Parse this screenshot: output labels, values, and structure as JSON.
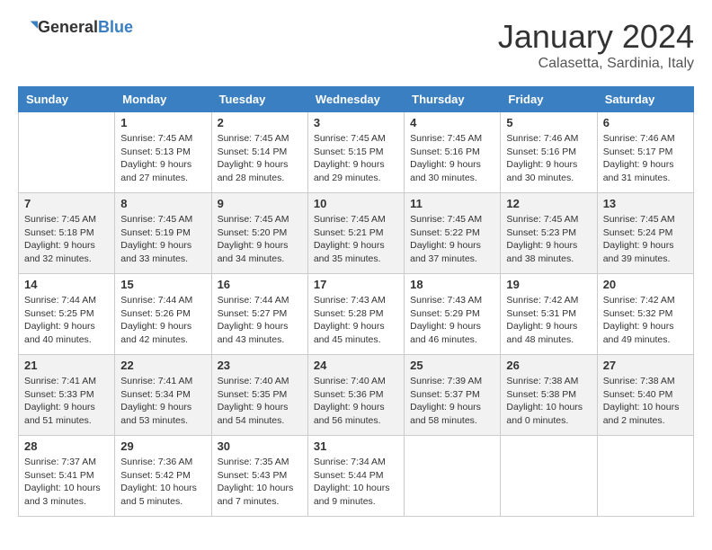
{
  "header": {
    "logo_general": "General",
    "logo_blue": "Blue",
    "month_year": "January 2024",
    "location": "Calasetta, Sardinia, Italy"
  },
  "days_of_week": [
    "Sunday",
    "Monday",
    "Tuesday",
    "Wednesday",
    "Thursday",
    "Friday",
    "Saturday"
  ],
  "weeks": [
    [
      {
        "day": "",
        "sunrise": "",
        "sunset": "",
        "daylight": ""
      },
      {
        "day": "1",
        "sunrise": "Sunrise: 7:45 AM",
        "sunset": "Sunset: 5:13 PM",
        "daylight": "Daylight: 9 hours and 27 minutes."
      },
      {
        "day": "2",
        "sunrise": "Sunrise: 7:45 AM",
        "sunset": "Sunset: 5:14 PM",
        "daylight": "Daylight: 9 hours and 28 minutes."
      },
      {
        "day": "3",
        "sunrise": "Sunrise: 7:45 AM",
        "sunset": "Sunset: 5:15 PM",
        "daylight": "Daylight: 9 hours and 29 minutes."
      },
      {
        "day": "4",
        "sunrise": "Sunrise: 7:45 AM",
        "sunset": "Sunset: 5:16 PM",
        "daylight": "Daylight: 9 hours and 30 minutes."
      },
      {
        "day": "5",
        "sunrise": "Sunrise: 7:46 AM",
        "sunset": "Sunset: 5:16 PM",
        "daylight": "Daylight: 9 hours and 30 minutes."
      },
      {
        "day": "6",
        "sunrise": "Sunrise: 7:46 AM",
        "sunset": "Sunset: 5:17 PM",
        "daylight": "Daylight: 9 hours and 31 minutes."
      }
    ],
    [
      {
        "day": "7",
        "sunrise": "Sunrise: 7:45 AM",
        "sunset": "Sunset: 5:18 PM",
        "daylight": "Daylight: 9 hours and 32 minutes."
      },
      {
        "day": "8",
        "sunrise": "Sunrise: 7:45 AM",
        "sunset": "Sunset: 5:19 PM",
        "daylight": "Daylight: 9 hours and 33 minutes."
      },
      {
        "day": "9",
        "sunrise": "Sunrise: 7:45 AM",
        "sunset": "Sunset: 5:20 PM",
        "daylight": "Daylight: 9 hours and 34 minutes."
      },
      {
        "day": "10",
        "sunrise": "Sunrise: 7:45 AM",
        "sunset": "Sunset: 5:21 PM",
        "daylight": "Daylight: 9 hours and 35 minutes."
      },
      {
        "day": "11",
        "sunrise": "Sunrise: 7:45 AM",
        "sunset": "Sunset: 5:22 PM",
        "daylight": "Daylight: 9 hours and 37 minutes."
      },
      {
        "day": "12",
        "sunrise": "Sunrise: 7:45 AM",
        "sunset": "Sunset: 5:23 PM",
        "daylight": "Daylight: 9 hours and 38 minutes."
      },
      {
        "day": "13",
        "sunrise": "Sunrise: 7:45 AM",
        "sunset": "Sunset: 5:24 PM",
        "daylight": "Daylight: 9 hours and 39 minutes."
      }
    ],
    [
      {
        "day": "14",
        "sunrise": "Sunrise: 7:44 AM",
        "sunset": "Sunset: 5:25 PM",
        "daylight": "Daylight: 9 hours and 40 minutes."
      },
      {
        "day": "15",
        "sunrise": "Sunrise: 7:44 AM",
        "sunset": "Sunset: 5:26 PM",
        "daylight": "Daylight: 9 hours and 42 minutes."
      },
      {
        "day": "16",
        "sunrise": "Sunrise: 7:44 AM",
        "sunset": "Sunset: 5:27 PM",
        "daylight": "Daylight: 9 hours and 43 minutes."
      },
      {
        "day": "17",
        "sunrise": "Sunrise: 7:43 AM",
        "sunset": "Sunset: 5:28 PM",
        "daylight": "Daylight: 9 hours and 45 minutes."
      },
      {
        "day": "18",
        "sunrise": "Sunrise: 7:43 AM",
        "sunset": "Sunset: 5:29 PM",
        "daylight": "Daylight: 9 hours and 46 minutes."
      },
      {
        "day": "19",
        "sunrise": "Sunrise: 7:42 AM",
        "sunset": "Sunset: 5:31 PM",
        "daylight": "Daylight: 9 hours and 48 minutes."
      },
      {
        "day": "20",
        "sunrise": "Sunrise: 7:42 AM",
        "sunset": "Sunset: 5:32 PM",
        "daylight": "Daylight: 9 hours and 49 minutes."
      }
    ],
    [
      {
        "day": "21",
        "sunrise": "Sunrise: 7:41 AM",
        "sunset": "Sunset: 5:33 PM",
        "daylight": "Daylight: 9 hours and 51 minutes."
      },
      {
        "day": "22",
        "sunrise": "Sunrise: 7:41 AM",
        "sunset": "Sunset: 5:34 PM",
        "daylight": "Daylight: 9 hours and 53 minutes."
      },
      {
        "day": "23",
        "sunrise": "Sunrise: 7:40 AM",
        "sunset": "Sunset: 5:35 PM",
        "daylight": "Daylight: 9 hours and 54 minutes."
      },
      {
        "day": "24",
        "sunrise": "Sunrise: 7:40 AM",
        "sunset": "Sunset: 5:36 PM",
        "daylight": "Daylight: 9 hours and 56 minutes."
      },
      {
        "day": "25",
        "sunrise": "Sunrise: 7:39 AM",
        "sunset": "Sunset: 5:37 PM",
        "daylight": "Daylight: 9 hours and 58 minutes."
      },
      {
        "day": "26",
        "sunrise": "Sunrise: 7:38 AM",
        "sunset": "Sunset: 5:38 PM",
        "daylight": "Daylight: 10 hours and 0 minutes."
      },
      {
        "day": "27",
        "sunrise": "Sunrise: 7:38 AM",
        "sunset": "Sunset: 5:40 PM",
        "daylight": "Daylight: 10 hours and 2 minutes."
      }
    ],
    [
      {
        "day": "28",
        "sunrise": "Sunrise: 7:37 AM",
        "sunset": "Sunset: 5:41 PM",
        "daylight": "Daylight: 10 hours and 3 minutes."
      },
      {
        "day": "29",
        "sunrise": "Sunrise: 7:36 AM",
        "sunset": "Sunset: 5:42 PM",
        "daylight": "Daylight: 10 hours and 5 minutes."
      },
      {
        "day": "30",
        "sunrise": "Sunrise: 7:35 AM",
        "sunset": "Sunset: 5:43 PM",
        "daylight": "Daylight: 10 hours and 7 minutes."
      },
      {
        "day": "31",
        "sunrise": "Sunrise: 7:34 AM",
        "sunset": "Sunset: 5:44 PM",
        "daylight": "Daylight: 10 hours and 9 minutes."
      },
      {
        "day": "",
        "sunrise": "",
        "sunset": "",
        "daylight": ""
      },
      {
        "day": "",
        "sunrise": "",
        "sunset": "",
        "daylight": ""
      },
      {
        "day": "",
        "sunrise": "",
        "sunset": "",
        "daylight": ""
      }
    ]
  ]
}
